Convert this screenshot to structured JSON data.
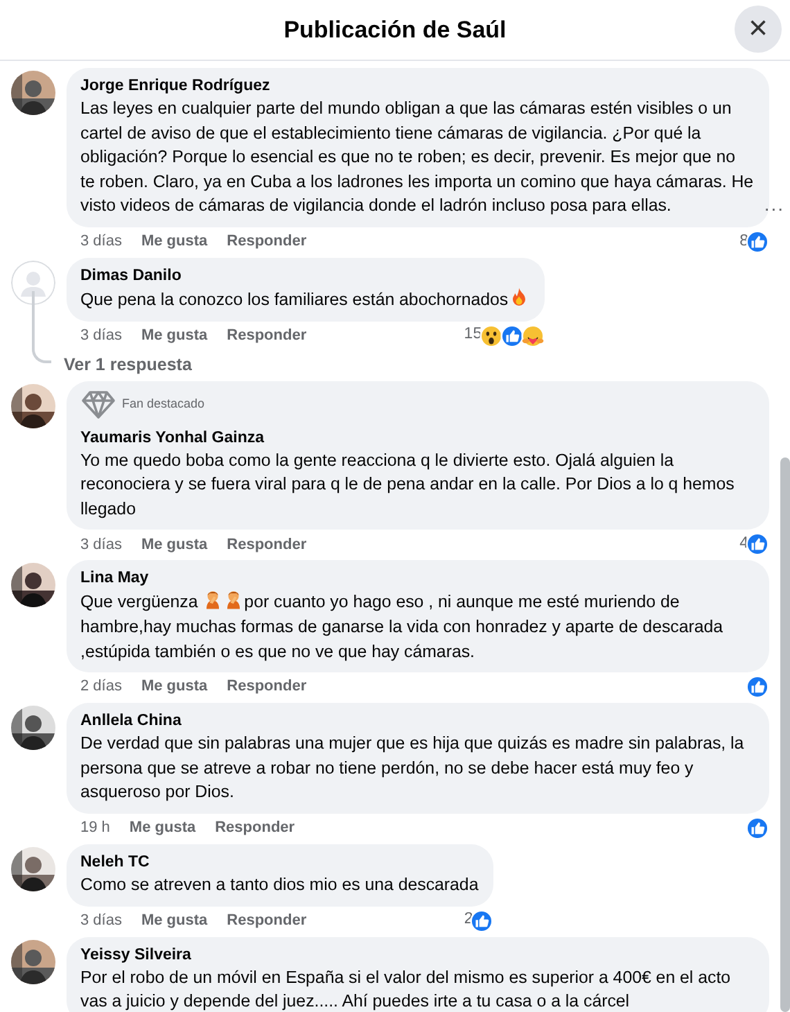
{
  "header": {
    "title": "Publicación de Saúl",
    "close": "×"
  },
  "more": "...",
  "comments": [
    {
      "name": "Jorge Enrique Rodríguez",
      "default_avatar": false,
      "segments": [
        {
          "kind": "text",
          "text": "Las leyes en cualquier parte del mundo obligan a que las cámaras estén visibles o un cartel de aviso de que el establecimiento tiene cámaras de vigilancia. ¿Por qué la obligación? Porque lo esencial es que no te roben; es decir, prevenir. Es mejor que no te roben. Claro, ya en Cuba a los ladrones les importa un comino que haya cámaras. He visto videos de cámaras de vigilancia donde el ladrón incluso posa para ellas."
        }
      ],
      "time": "3 días",
      "like": "Me gusta",
      "reply": "Responder",
      "reaction_count": "8",
      "reactions": [
        {
          "kind": "like"
        }
      ]
    },
    {
      "name": "Dimas Danilo",
      "default_avatar": true,
      "segments": [
        {
          "kind": "text",
          "text": "Que pena la conozco los familiares están abochornados"
        },
        {
          "kind": "fire"
        }
      ],
      "time": "3 días",
      "like": "Me gusta",
      "reply": "Responder",
      "reaction_count": "15",
      "reactions": [
        {
          "kind": "wow"
        },
        {
          "kind": "like"
        },
        {
          "kind": "care"
        }
      ],
      "replies_link": "Ver 1 respuesta"
    },
    {
      "name": "Yaumaris Yonhal Gainza",
      "default_avatar": false,
      "badge": "Fan destacado",
      "segments": [
        {
          "kind": "text",
          "text": "Yo me quedo boba como la gente reacciona q le divierte esto. Ojalá alguien la reconociera y se fuera viral para q le de pena andar en la calle. Por Dios a lo q hemos llegado"
        }
      ],
      "time": "3 días",
      "like": "Me gusta",
      "reply": "Responder",
      "reaction_count": "4",
      "reactions": [
        {
          "kind": "like"
        }
      ]
    },
    {
      "name": "Lina May",
      "default_avatar": false,
      "segments": [
        {
          "kind": "text",
          "text": "Que vergüenza "
        },
        {
          "kind": "facepalm"
        },
        {
          "kind": "facepalm"
        },
        {
          "kind": "text",
          "text": "por cuanto yo hago eso , ni aunque me esté muriendo de hambre,hay muchas formas de ganarse la vida con honradez y aparte de descarada ,estúpida también o es que no ve que hay cámaras."
        }
      ],
      "time": "2 días",
      "like": "Me gusta",
      "reply": "Responder",
      "reactions": [
        {
          "kind": "like"
        }
      ]
    },
    {
      "name": "Anllela China",
      "default_avatar": false,
      "segments": [
        {
          "kind": "text",
          "text": "De verdad que sin palabras una mujer que es hija que quizás es madre sin palabras, la persona que se atreve a robar no tiene perdón, no se debe hacer está muy feo y asqueroso por Dios."
        }
      ],
      "time": "19 h",
      "like": "Me gusta",
      "reply": "Responder",
      "reactions": [
        {
          "kind": "like"
        }
      ]
    },
    {
      "name": "Neleh TC",
      "default_avatar": false,
      "segments": [
        {
          "kind": "text",
          "text": "Como se atreven a tanto dios mio es una descarada"
        }
      ],
      "time": "3 días",
      "like": "Me gusta",
      "reply": "Responder",
      "reaction_count": "2",
      "reactions": [
        {
          "kind": "like"
        }
      ]
    },
    {
      "name": "Yeissy Silveira",
      "default_avatar": false,
      "segments": [
        {
          "kind": "text",
          "text": "Por el robo de un móvil en España si el valor del mismo es superior a 400€ en el acto vas a juicio y depende del juez..... Ahí puedes irte a tu casa o a la cárcel"
        }
      ]
    }
  ]
}
